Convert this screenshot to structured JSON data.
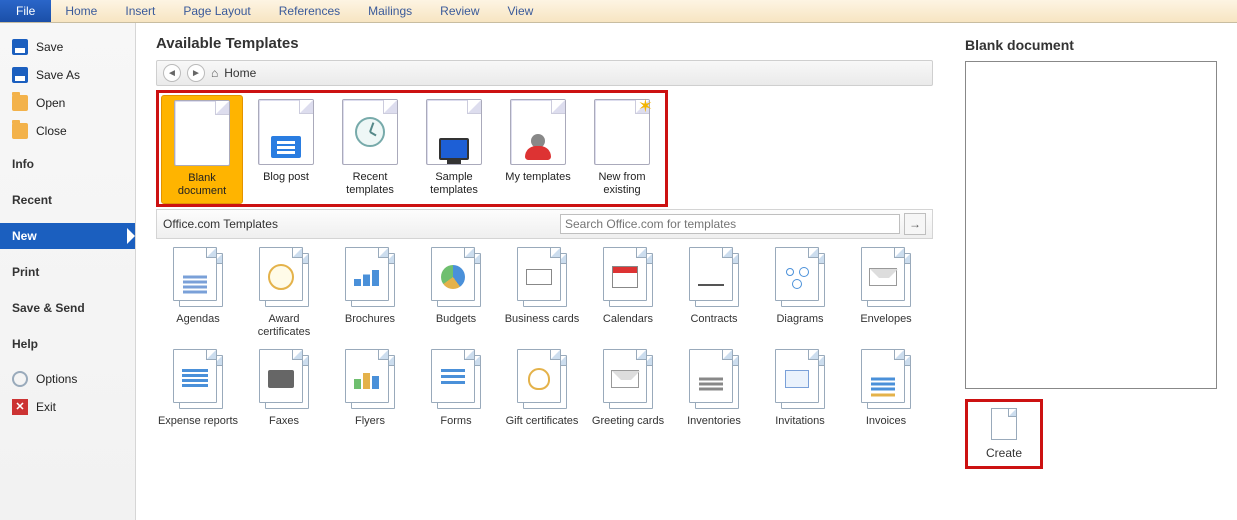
{
  "ribbon": {
    "file": "File",
    "tabs": [
      "Home",
      "Insert",
      "Page Layout",
      "References",
      "Mailings",
      "Review",
      "View"
    ]
  },
  "side": {
    "save": "Save",
    "save_as": "Save As",
    "open": "Open",
    "close": "Close",
    "info": "Info",
    "recent": "Recent",
    "new": "New",
    "print": "Print",
    "save_send": "Save & Send",
    "help": "Help",
    "options": "Options",
    "exit": "Exit"
  },
  "main": {
    "title": "Available Templates",
    "crumb_home": "Home",
    "section_office": "Office.com Templates",
    "search_placeholder": "Search Office.com for templates",
    "row1": [
      {
        "label": "Blank document"
      },
      {
        "label": "Blog post"
      },
      {
        "label": "Recent templates"
      },
      {
        "label": "Sample templates"
      },
      {
        "label": "My templates"
      },
      {
        "label": "New from existing"
      }
    ],
    "grid": [
      {
        "label": "Agendas",
        "icon": "mini-lines"
      },
      {
        "label": "Award certificates",
        "icon": "mini-badge"
      },
      {
        "label": "Brochures",
        "icon": "mini-chart"
      },
      {
        "label": "Budgets",
        "icon": "mini-pie"
      },
      {
        "label": "Business cards",
        "icon": "mini-card"
      },
      {
        "label": "Calendars",
        "icon": "mini-cal"
      },
      {
        "label": "Contracts",
        "icon": "mini-sig"
      },
      {
        "label": "Diagrams",
        "icon": "mini-diag"
      },
      {
        "label": "Envelopes",
        "icon": "mini-env"
      },
      {
        "label": "Expense reports",
        "icon": "mini-table"
      },
      {
        "label": "Faxes",
        "icon": "mini-fax"
      },
      {
        "label": "Flyers",
        "icon": "mini-bar"
      },
      {
        "label": "Forms",
        "icon": "mini-form"
      },
      {
        "label": "Gift certificates",
        "icon": "mini-gift"
      },
      {
        "label": "Greeting cards",
        "icon": "mini-env"
      },
      {
        "label": "Inventories",
        "icon": "mini-inv"
      },
      {
        "label": "Invitations",
        "icon": "mini-invite"
      },
      {
        "label": "Invoices",
        "icon": "mini-invoice"
      }
    ]
  },
  "preview": {
    "title": "Blank document",
    "create": "Create"
  }
}
